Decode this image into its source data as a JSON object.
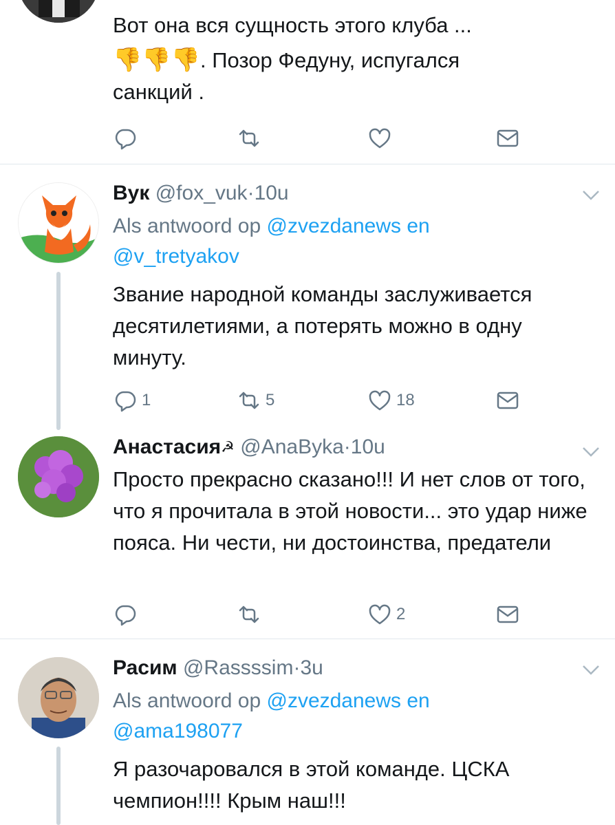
{
  "colors": {
    "accent": "#1da1f2",
    "muted": "#657786",
    "text": "#14171a",
    "divider": "#e1e8ed",
    "thread": "#ccd6dd"
  },
  "tweets": [
    {
      "body_line1": "Вот она вся сущность этого клуба ...",
      "emoji": "👎👎👎",
      "body_line2": ". Позор Федуну, испугался",
      "body_line3": "санкций .",
      "actions": {
        "reply": "",
        "retweet": "",
        "like": "",
        "dm": ""
      }
    },
    {
      "name": "Вук",
      "handle": "@fox_vuk",
      "dot": "·",
      "time": "10u",
      "reply_prefix": "Als antwoord op",
      "reply_mention1": "@zvezdanews",
      "reply_and": "en",
      "reply_mention2": "@v_tretyakov",
      "body": "Звание народной команды заслуживается десятилетиями, а потерять можно в одну минуту.",
      "actions": {
        "reply": "1",
        "retweet": "5",
        "like": "18",
        "dm": ""
      }
    },
    {
      "name": "Анастасия",
      "name_symbol": "☭",
      "handle": "@AnaByka",
      "dot": "·",
      "time": "10u",
      "body": "Просто прекрасно сказано!!! И нет слов от того, что я прочитала в этой новости... это удар ниже пояса. Ни чести, ни достоинства, предатели",
      "actions": {
        "reply": "",
        "retweet": "",
        "like": "2",
        "dm": ""
      }
    },
    {
      "name": "Расим",
      "handle": "@Rassssim",
      "dot": "·",
      "time": "3u",
      "reply_prefix": "Als antwoord op",
      "reply_mention1": "@zvezdanews",
      "reply_and": "en",
      "reply_mention2": "@ama198077",
      "body": "Я разочаровался в этой команде. ЦСКА чемпион!!!! Крым наш!!!"
    }
  ]
}
